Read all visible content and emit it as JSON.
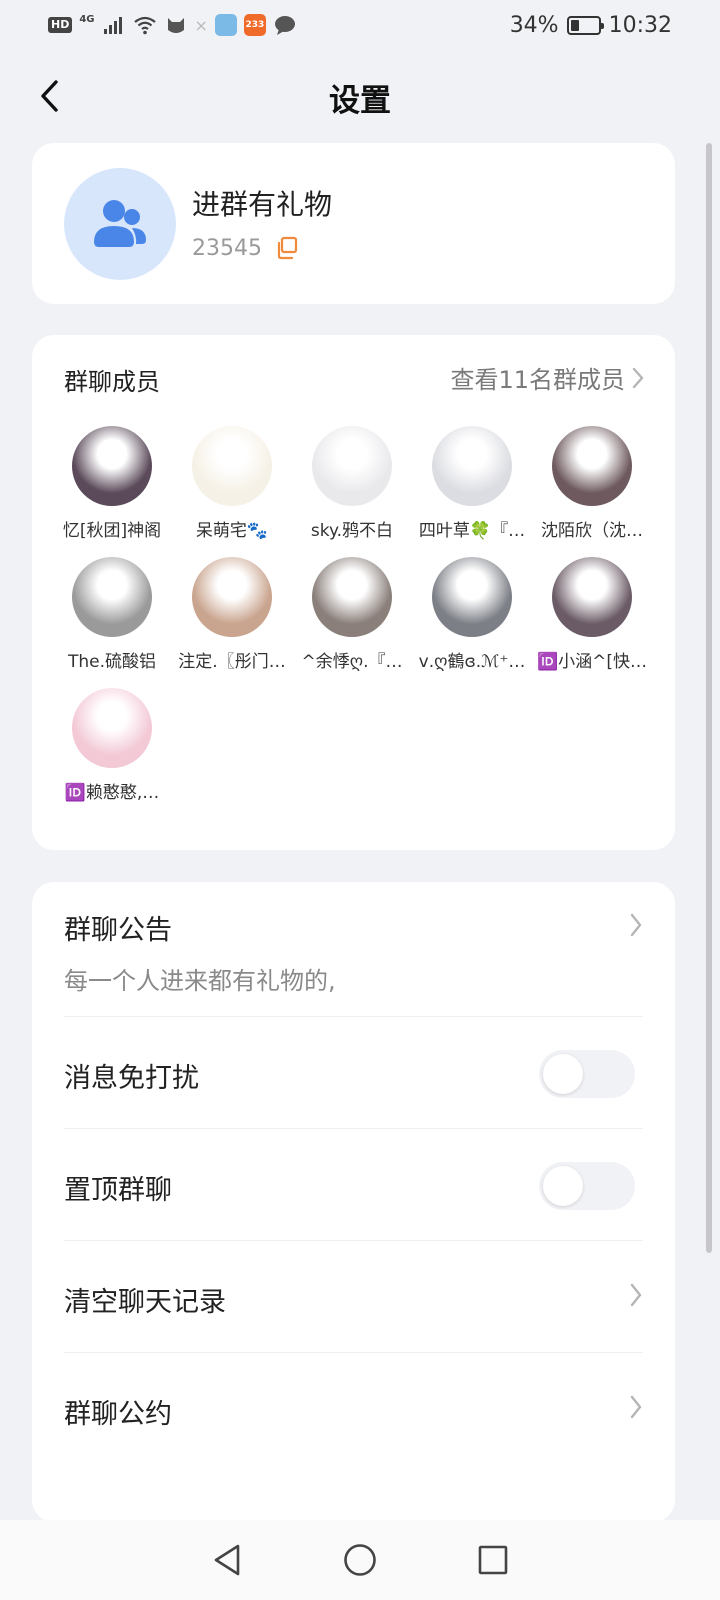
{
  "status_bar": {
    "hd": "HD",
    "network": "4G",
    "app_badge": "233",
    "battery": "34%",
    "battery_level": 0.34,
    "time": "10:32",
    "icons": [
      "hd-icon",
      "signal-icon",
      "wifi-icon",
      "cat-icon",
      "close-icon",
      "app-icon",
      "app-233-icon",
      "chat-bubble-icon"
    ]
  },
  "header": {
    "title": "设置",
    "back_icon": "chevron-left-icon"
  },
  "group": {
    "name": "进群有礼物",
    "id": "23545",
    "avatar_icon": "group-users-icon",
    "copy_icon": "copy-icon",
    "accent": "#4a86e8",
    "copy_color": "#f08a3c"
  },
  "members": {
    "title": "群聊成员",
    "view_all": "查看11名群成员",
    "list": [
      {
        "name": "忆[秋团]神阁",
        "avatar_color": "#5b4a5a"
      },
      {
        "name": "呆萌宅🐾",
        "avatar_color": "#f6f1e6"
      },
      {
        "name": "sky.鸦不白",
        "avatar_color": "#e9e9ec"
      },
      {
        "name": "四叶草🍀『…",
        "avatar_color": "#dcdde2"
      },
      {
        "name": "沈陌欣（沈…",
        "avatar_color": "#6e5a5e"
      },
      {
        "name": "The.硫酸铝",
        "avatar_color": "#9a9a9a"
      },
      {
        "name": "注定.〖彤门…",
        "avatar_color": "#c9a48e"
      },
      {
        "name": "^余悸ღ.『…",
        "avatar_color": "#8a7f7a"
      },
      {
        "name": "ⅴ.ღ鶴ɞ.ℳ⁺…",
        "avatar_color": "#7c7f86"
      },
      {
        "name": "🆔小涵^[快…",
        "avatar_color": "#6b5b66"
      },
      {
        "name": "🆔赖憨憨,…",
        "avatar_color": "#f3c9d6"
      }
    ]
  },
  "settings": {
    "announcement_label": "群聊公告",
    "announcement_text": "每一个人进来都有礼物的,",
    "dnd_label": "消息免打扰",
    "dnd_on": false,
    "pin_label": "置顶群聊",
    "pin_on": false,
    "clear_label": "清空聊天记录",
    "rules_label": "群聊公约"
  },
  "nav": {
    "icons": [
      "back-triangle-icon",
      "home-circle-icon",
      "recents-square-icon"
    ]
  }
}
